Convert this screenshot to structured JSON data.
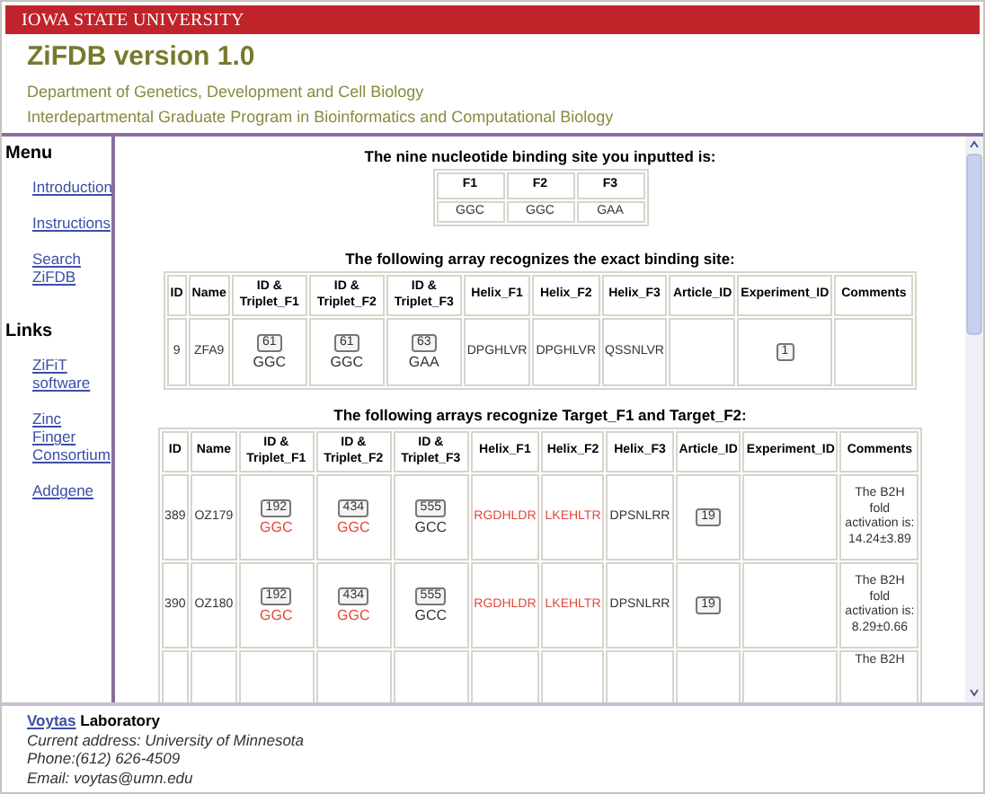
{
  "banner": {
    "university": "IOWA STATE UNIVERSITY"
  },
  "masthead": {
    "title": "ZiFDB version 1.0",
    "lines": [
      "Department of Genetics, Development and Cell Biology",
      "Interdepartmental Graduate Program in Bioinformatics and Computational Biology"
    ]
  },
  "sidebar": {
    "sections": [
      {
        "heading": "Menu",
        "links": [
          "Introduction",
          "Instructions",
          "Search ZiFDB"
        ]
      },
      {
        "heading": "Links",
        "links": [
          "ZiFiT software",
          "Zinc Finger Consortium",
          "Addgene"
        ]
      }
    ]
  },
  "site": {
    "caption": "The nine nucleotide binding site you inputted is:",
    "columns": [
      "F1",
      "F2",
      "F3"
    ],
    "values": [
      "GGC",
      "GGC",
      "GAA"
    ]
  },
  "exact": {
    "caption": "The following array recognizes the exact binding site:",
    "columns": [
      "ID",
      "Name",
      "ID & Triplet_F1",
      "ID & Triplet_F2",
      "ID & Triplet_F3",
      "Helix_F1",
      "Helix_F2",
      "Helix_F3",
      "Article_ID",
      "Experiment_ID",
      "Comments"
    ],
    "rows": [
      {
        "id": "9",
        "name": "ZFA9",
        "triplets": [
          {
            "id": "61",
            "triplet": "GGC",
            "match": false
          },
          {
            "id": "61",
            "triplet": "GGC",
            "match": false
          },
          {
            "id": "63",
            "triplet": "GAA",
            "match": false
          }
        ],
        "helices": [
          {
            "text": "DPGHLVR",
            "match": false
          },
          {
            "text": "DPGHLVR",
            "match": false
          },
          {
            "text": "QSSNLVR",
            "match": false
          }
        ],
        "article_id": "",
        "experiment_id": "1",
        "comments": ""
      }
    ]
  },
  "partial": {
    "caption": "The following arrays recognize Target_F1 and Target_F2:",
    "columns": [
      "ID",
      "Name",
      "ID & Triplet_F1",
      "ID & Triplet_F2",
      "ID & Triplet_F3",
      "Helix_F1",
      "Helix_F2",
      "Helix_F3",
      "Article_ID",
      "Experiment_ID",
      "Comments"
    ],
    "rows": [
      {
        "id": "389",
        "name": "OZ179",
        "triplets": [
          {
            "id": "192",
            "triplet": "GGC",
            "match": true
          },
          {
            "id": "434",
            "triplet": "GGC",
            "match": true
          },
          {
            "id": "555",
            "triplet": "GCC",
            "match": false
          }
        ],
        "helices": [
          {
            "text": "RGDHLDR",
            "match": true
          },
          {
            "text": "LKEHLTR",
            "match": true
          },
          {
            "text": "DPSNLRR",
            "match": false
          }
        ],
        "article_id": "19",
        "experiment_id": "",
        "comments": "The B2H fold activation is: 14.24±3.89"
      },
      {
        "id": "390",
        "name": "OZ180",
        "triplets": [
          {
            "id": "192",
            "triplet": "GGC",
            "match": true
          },
          {
            "id": "434",
            "triplet": "GGC",
            "match": true
          },
          {
            "id": "555",
            "triplet": "GCC",
            "match": false
          }
        ],
        "helices": [
          {
            "text": "RGDHLDR",
            "match": true
          },
          {
            "text": "LKEHLTR",
            "match": true
          },
          {
            "text": "DPSNLRR",
            "match": false
          }
        ],
        "article_id": "19",
        "experiment_id": "",
        "comments": "The B2H fold activation is: 8.29±0.66"
      },
      {
        "id": "",
        "name": "",
        "triplets": [],
        "helices": [],
        "article_id": "",
        "experiment_id": "",
        "comments": "The B2H"
      }
    ]
  },
  "footer": {
    "lab_link": "Voytas",
    "lab_rest": "Laboratory",
    "lines": [
      "Current address: University of Minnesota",
      "Phone:(612) 626-4509",
      "Email: voytas@umn.edu"
    ]
  }
}
